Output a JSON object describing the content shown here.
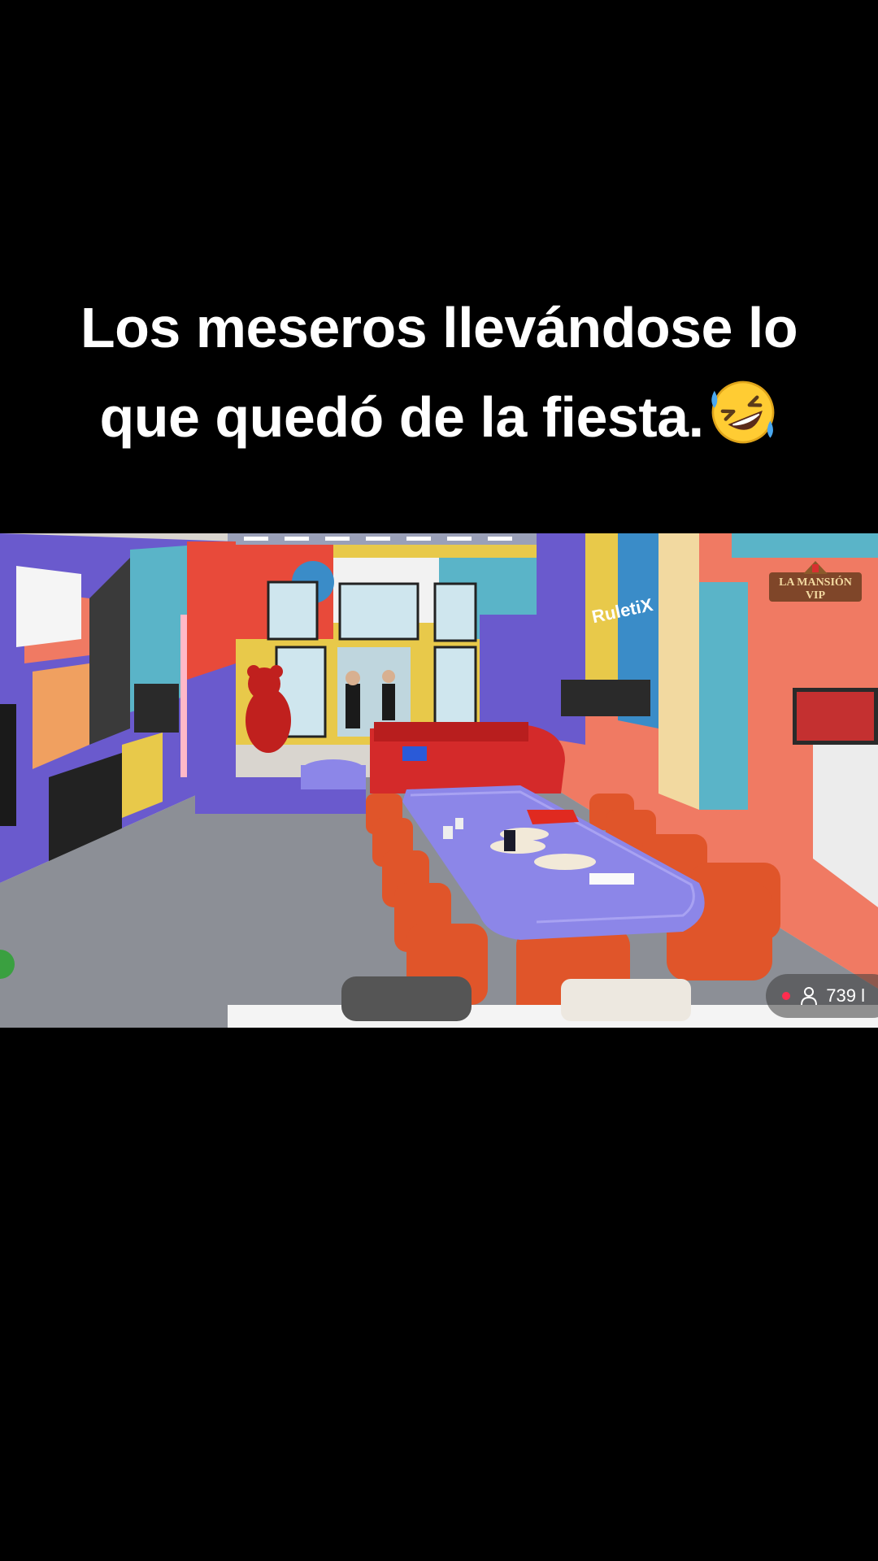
{
  "caption": {
    "line1": "Los meseros llevándose lo",
    "line2": "que quedó de la fiesta."
  },
  "emoji": "rolling-on-floor-laughing",
  "video": {
    "watermark_line1": "LA MANSIÓN",
    "watermark_line2": "VIP",
    "sign_text": "RuletiX",
    "viewer_count": "739 l"
  },
  "colors": {
    "background": "#000000",
    "caption_text": "#ffffff",
    "live_dot": "#ff2d4f",
    "wall_purple": "#6a5acd",
    "wall_coral": "#f07a63",
    "table_lavender": "#8c86e8",
    "sofa_red": "#d42a2a",
    "chair_orange": "#e0552a"
  }
}
